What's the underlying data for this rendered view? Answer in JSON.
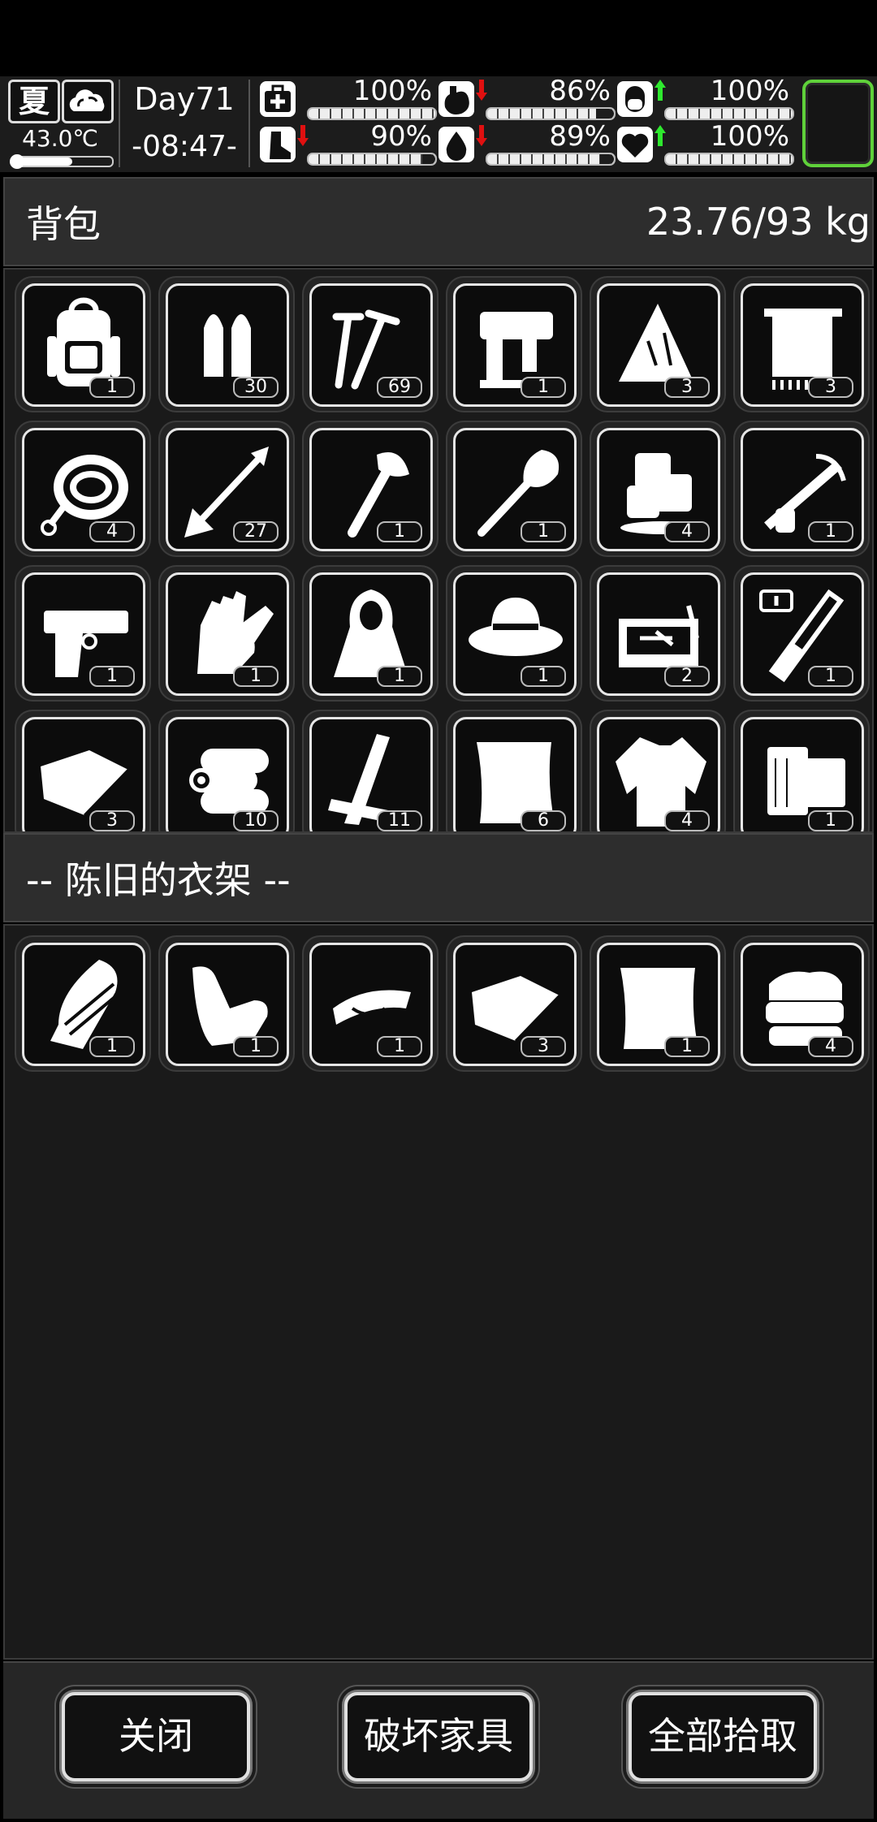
{
  "hud": {
    "season": "夏",
    "weather_icon": "cloud-icon",
    "temperature": "43.0℃",
    "temperature_level": 0.6,
    "day": "Day71",
    "time": "-08:47-",
    "stats": [
      {
        "id": "health",
        "icon": "first-aid-icon",
        "value": "100%",
        "level": 1.0,
        "trend": "none"
      },
      {
        "id": "hunger",
        "icon": "stomach-icon",
        "value": "86%",
        "level": 0.86,
        "trend": "down"
      },
      {
        "id": "mood",
        "icon": "capsule-icon",
        "value": "100%",
        "level": 1.0,
        "trend": "up"
      },
      {
        "id": "stamina",
        "icon": "foot-icon",
        "value": "90%",
        "level": 0.9,
        "trend": "down"
      },
      {
        "id": "thirst",
        "icon": "water-drop-icon",
        "value": "89%",
        "level": 0.89,
        "trend": "down"
      },
      {
        "id": "vitality",
        "icon": "heart-icon",
        "value": "100%",
        "level": 1.0,
        "trend": "up"
      }
    ],
    "colors": {
      "trend_up": "#2ee82e",
      "trend_down": "#e01010",
      "slot_border": "#5fd13a"
    }
  },
  "backpack": {
    "title": "背包",
    "weight": "23.76/93 kg",
    "items": [
      {
        "icon": "backpack-icon",
        "count": "1"
      },
      {
        "icon": "bullets-icon",
        "count": "30"
      },
      {
        "icon": "nails-icon",
        "count": "69"
      },
      {
        "icon": "nail-gun-icon",
        "count": "1"
      },
      {
        "icon": "cloth-scrap-icon",
        "count": "3"
      },
      {
        "icon": "towel-icon",
        "count": "3"
      },
      {
        "icon": "rope-icon",
        "count": "4"
      },
      {
        "icon": "arrow-icon",
        "count": "27"
      },
      {
        "icon": "axe-icon",
        "count": "1"
      },
      {
        "icon": "shovel-icon",
        "count": "1"
      },
      {
        "icon": "ice-icon",
        "count": "4"
      },
      {
        "icon": "crossbow-icon",
        "count": "1"
      },
      {
        "icon": "pistol-icon",
        "count": "1"
      },
      {
        "icon": "gloves-icon",
        "count": "1"
      },
      {
        "icon": "cloak-icon",
        "count": "1"
      },
      {
        "icon": "hat-icon",
        "count": "1"
      },
      {
        "icon": "toolbox-icon",
        "count": "2"
      },
      {
        "icon": "test-tube-icon",
        "count": "1"
      },
      {
        "icon": "cloth-icon",
        "count": "3"
      },
      {
        "icon": "logs-icon",
        "count": "10"
      },
      {
        "icon": "planks-icon",
        "count": "11"
      },
      {
        "icon": "fabric-icon",
        "count": "6"
      },
      {
        "icon": "torn-shirt-icon",
        "count": "4"
      },
      {
        "icon": "wood-block-icon",
        "count": "1"
      }
    ]
  },
  "container": {
    "title": "-- 陈旧的衣架 --",
    "items": [
      {
        "icon": "arm-guard-icon",
        "count": "1"
      },
      {
        "icon": "glove-icon",
        "count": "1"
      },
      {
        "icon": "visor-cap-icon",
        "count": "1"
      },
      {
        "icon": "cloth-icon",
        "count": "3"
      },
      {
        "icon": "fabric-icon",
        "count": "1"
      },
      {
        "icon": "folded-clothes-icon",
        "count": "4"
      }
    ]
  },
  "buttons": {
    "close": "关闭",
    "destroy": "破坏家具",
    "take_all": "全部拾取"
  }
}
